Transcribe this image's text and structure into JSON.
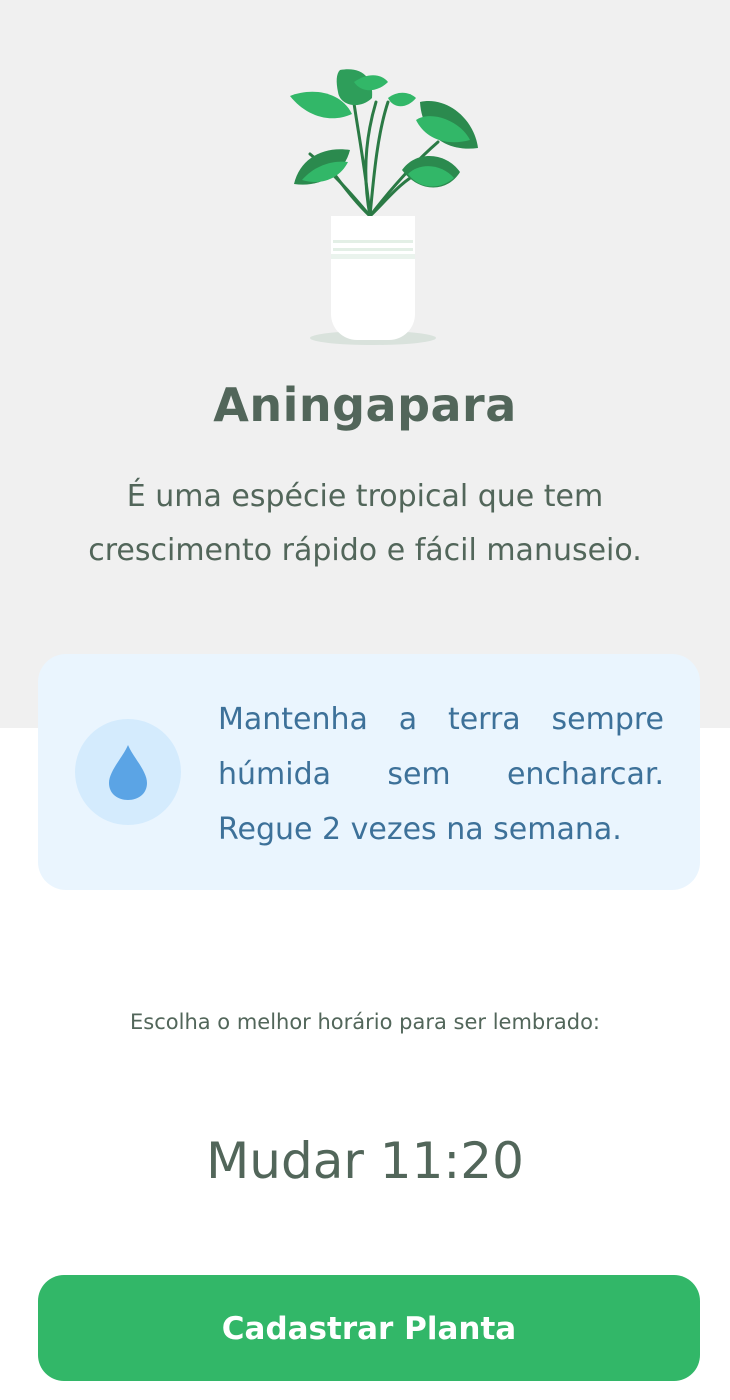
{
  "plant": {
    "name": "Aningapara",
    "about_line1": "É uma espécie tropical que tem",
    "about_line2": "crescimento rápido e fácil manuseio.",
    "illustration_icon": "potted-plant-icon"
  },
  "tip": {
    "icon": "water-drop-icon",
    "line1": "Mantenha a terra sempre",
    "line2": "húmida sem encharcar.",
    "line3": "Regue 2 vezes na semana."
  },
  "reminder": {
    "label": "Escolha o melhor horário para ser lembrado:",
    "change_time": "Mudar 11:20"
  },
  "actions": {
    "register_label": "Cadastrar Planta"
  },
  "colors": {
    "background_top": "#f0f0f0",
    "heading": "#52665a",
    "tip_background": "#eaf5fe",
    "tip_text": "#3d7199",
    "water_circle": "#d4ebfd",
    "water_drop": "#5ba4e5",
    "button": "#32b768",
    "leaf_light": "#32b768",
    "leaf_dark": "#2b8a4e"
  }
}
